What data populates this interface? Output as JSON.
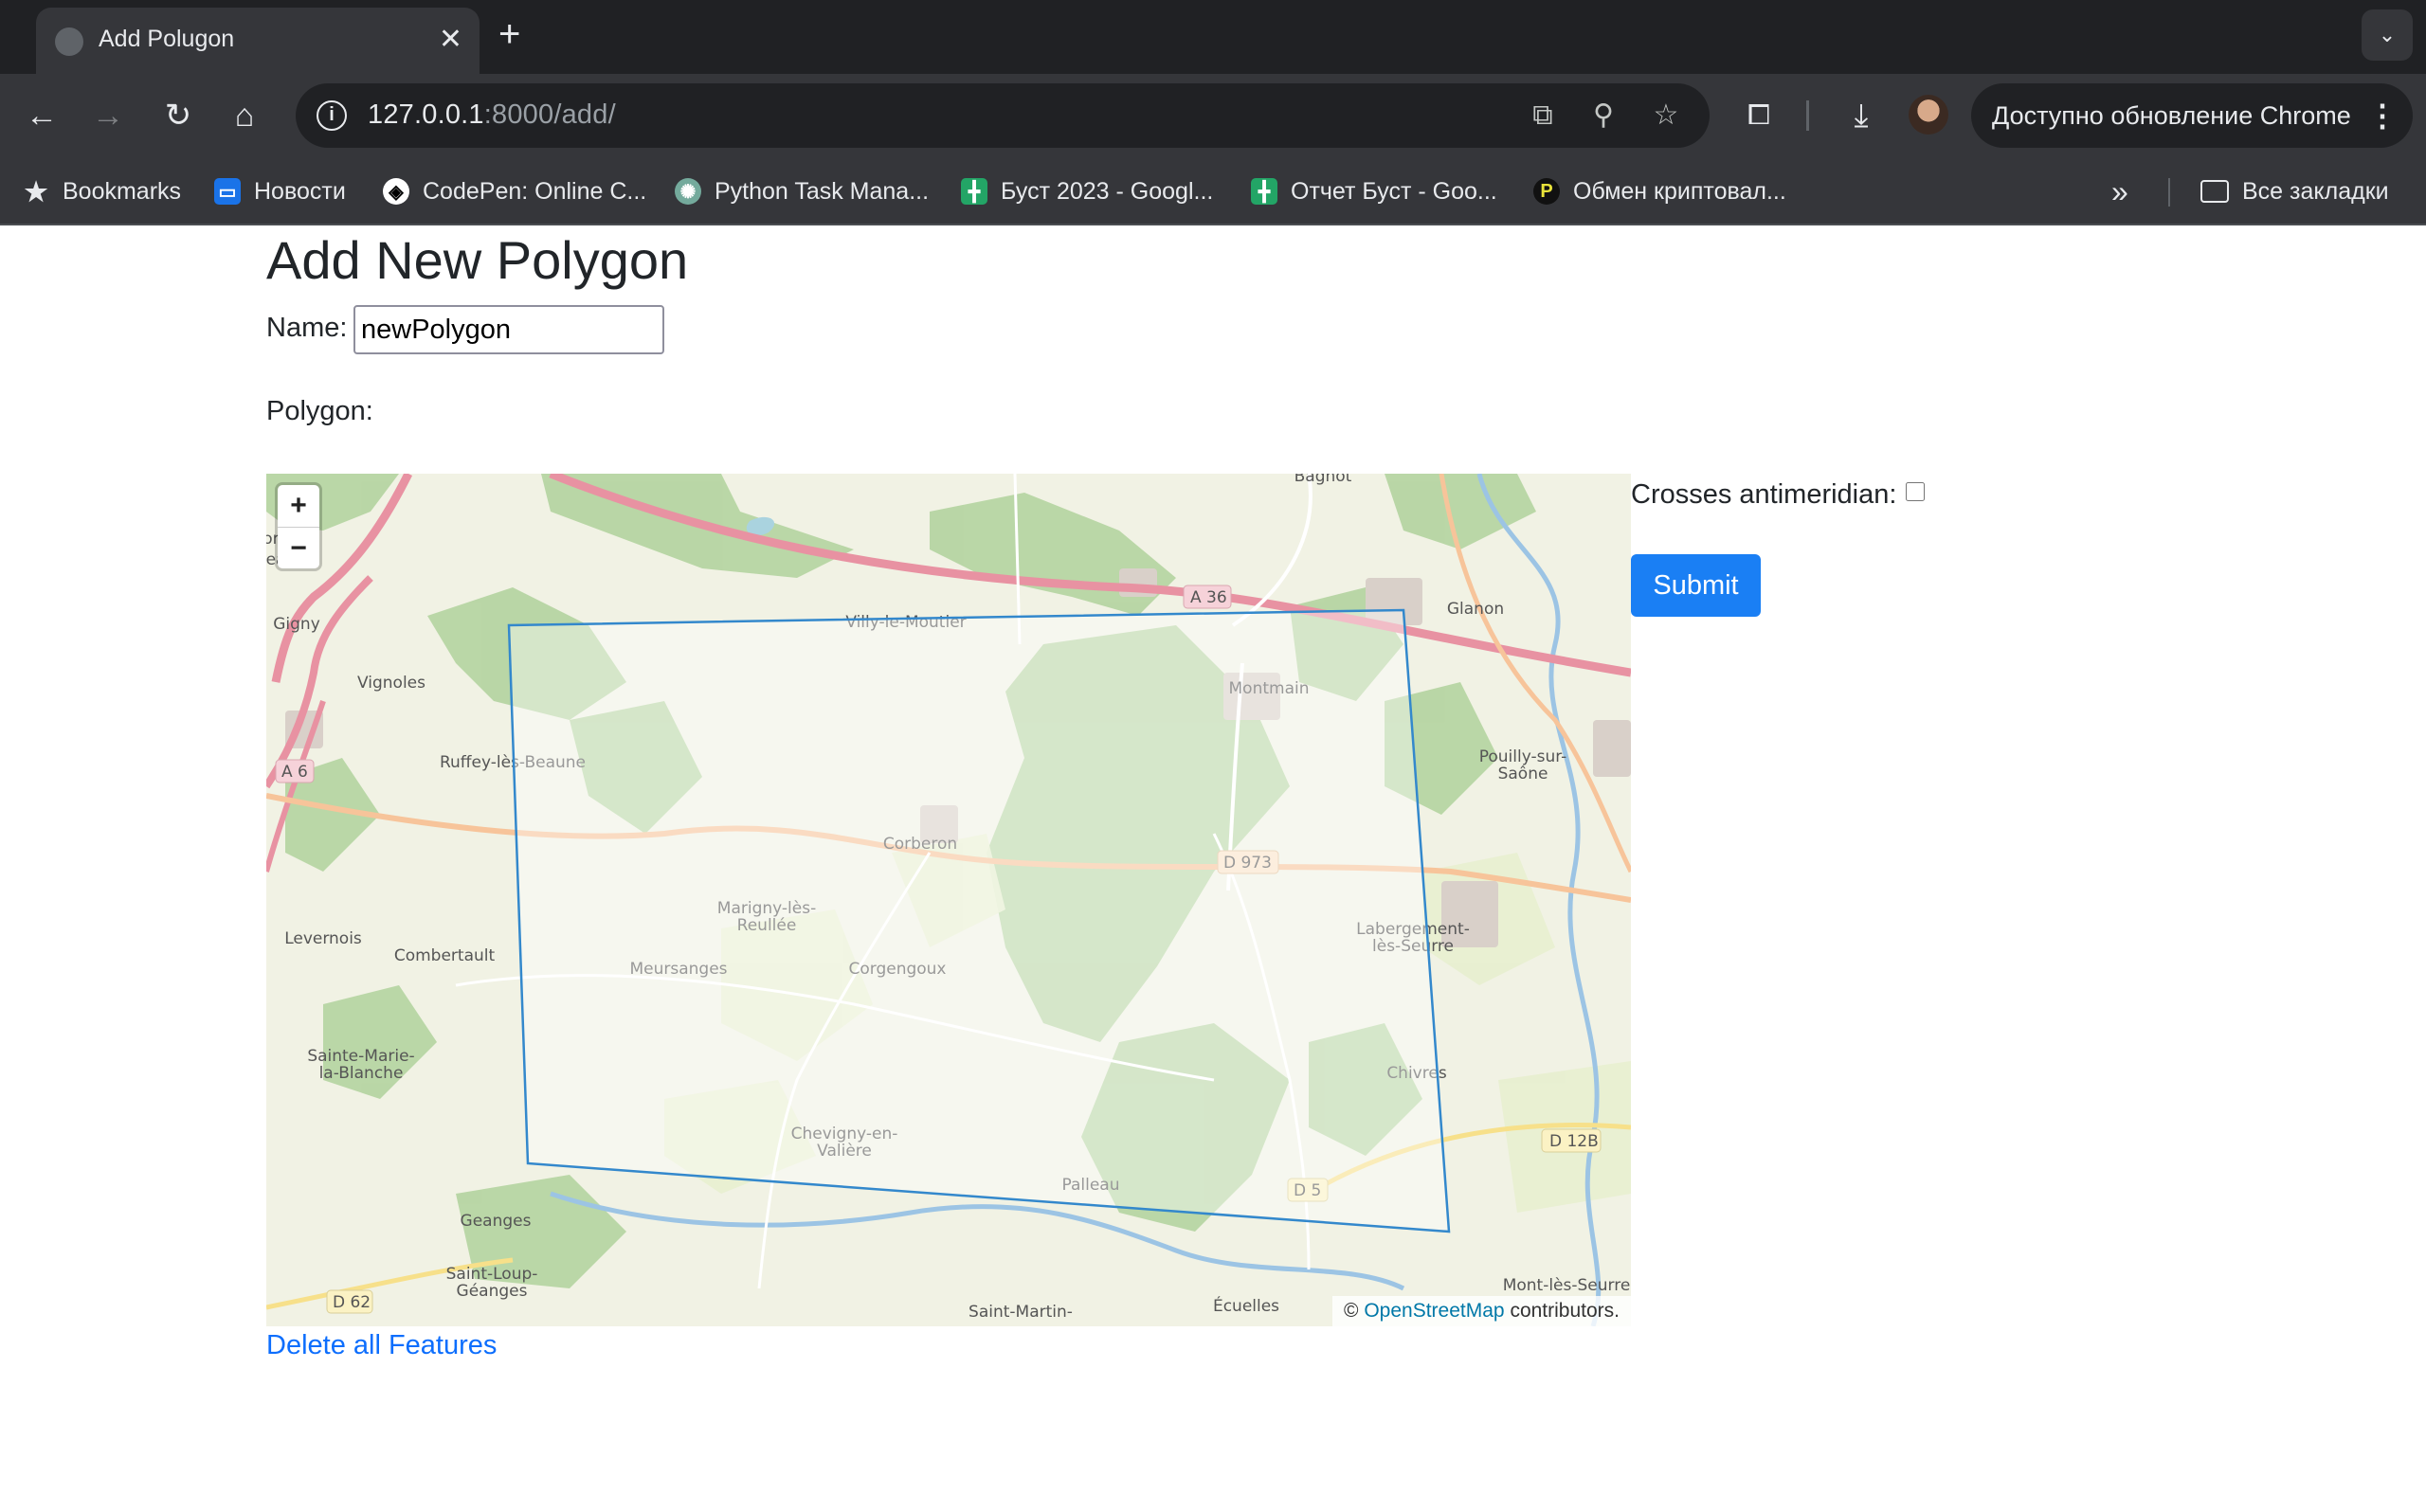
{
  "browser": {
    "tab": {
      "title": "Add Polugon",
      "close_glyph": "✕"
    },
    "new_tab_glyph": "+",
    "tab_search_glyph": "⌄",
    "url": {
      "host": "127.0.0.1",
      "rest": ":8000/add/"
    },
    "update_text": "Доступно обновление Chrome",
    "bookmarks": [
      {
        "label": "Bookmarks",
        "icon": "star-icon"
      },
      {
        "label": "Новости",
        "icon": "news-icon"
      },
      {
        "label": "CodePen: Online C...",
        "icon": "codepen-icon"
      },
      {
        "label": "Python Task Mana...",
        "icon": "chatgpt-icon"
      },
      {
        "label": "Буст 2023 - Googl...",
        "icon": "sheets-icon"
      },
      {
        "label": "Отчет Буст - Goo...",
        "icon": "sheets-icon"
      },
      {
        "label": "Обмен криптовал...",
        "icon": "exchange-icon"
      }
    ],
    "overflow_glyph": "»",
    "all_bookmarks": "Все закладки"
  },
  "page": {
    "title": "Add New Polygon",
    "name_label": "Name:",
    "name_value": "newPolygon",
    "polygon_label": "Polygon:",
    "antimeridian_label": "Crosses antimeridian:",
    "antimeridian_checked": false,
    "submit_label": "Submit",
    "delete_link": "Delete all Features"
  },
  "map": {
    "zoom_in": "+",
    "zoom_out": "−",
    "attribution_prefix": "© ",
    "attribution_link": "OpenStreetMap",
    "attribution_suffix": " contributors.",
    "polygon_color": "#3388cc",
    "places": [
      "Bagnot",
      "Gigny",
      "Vignoles",
      "Ruffey-lès-Beaune",
      "Villy-le-Moutier",
      "Montmain",
      "Glanon",
      "Pouilly-sur-",
      "Saône",
      "Corberon",
      "Marigny-lès-",
      "Reullée",
      "Meursanges",
      "Corgengoux",
      "Labergement-",
      "lès-Seurre",
      "Levernois",
      "Combertault",
      "Sainte-Marie-",
      "la-Blanche",
      "Chivres",
      "Chevigny-en-",
      "Valière",
      "Palleau",
      "Geanges",
      "Saint-Loup-",
      "Géanges",
      "Saint-Martin-",
      "Écuelles",
      "Mont-lès-Seurre",
      "ore",
      "ea"
    ],
    "roads": [
      "A 36",
      "A 6",
      "D 973",
      "D 12B",
      "D 5",
      "D 62"
    ]
  }
}
